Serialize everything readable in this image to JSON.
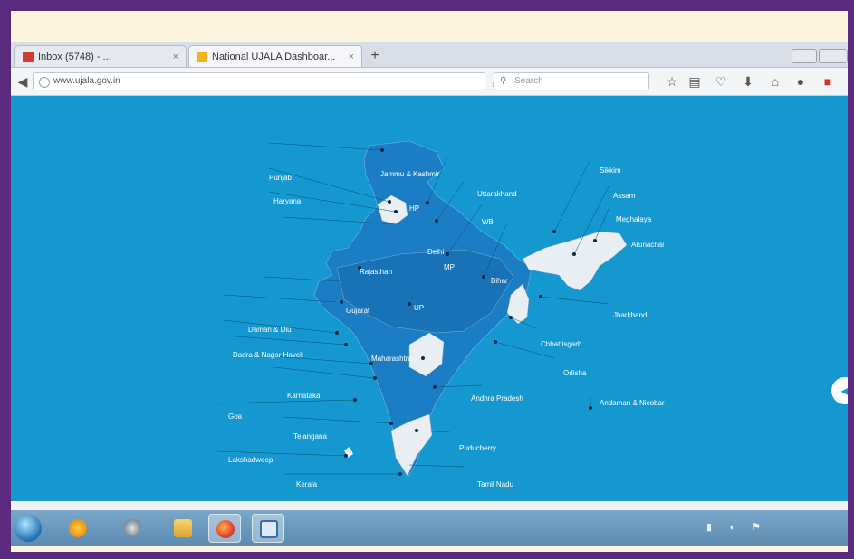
{
  "browser": {
    "tabs": [
      {
        "label": "Inbox (5748) - ...",
        "active": false,
        "icon": "gmail-icon"
      },
      {
        "label": "National UJALA Dashboar...",
        "active": true,
        "icon": "ujala-icon"
      }
    ],
    "tab_close_glyph": "×",
    "new_tab_glyph": "+",
    "url": "www.ujala.gov.in",
    "search_placeholder": "Search",
    "toolbar_icons": [
      "star-icon",
      "reading-list-icon",
      "pocket-icon",
      "download-icon",
      "home-icon",
      "chat-icon",
      "addon-icon"
    ]
  },
  "map": {
    "background": "#1598cf",
    "region_color": "#1b7ec4",
    "highlight_color": "#e8eef2",
    "state_labels": {
      "jk": "Jammu & Kashmir",
      "punjab": "Punjab",
      "haryana": "Haryana",
      "hp": "HP",
      "delhi": "Delhi",
      "uttarakhand": "Uttarakhand",
      "rajasthan": "Rajasthan",
      "up": "UP",
      "bihar": "Bihar",
      "gujarat": "Gujarat",
      "mp": "MP",
      "daman_diu": "Daman & Diu",
      "dnh": "Dadra & Nagar Haveli",
      "maharashtra": "Maharashtra",
      "goa": "Goa",
      "karnataka": "Karnataka",
      "telangana": "Telangana",
      "ap": "Andhra Pradesh",
      "kerala": "Kerala",
      "tamil_nadu": "Tamil Nadu",
      "puducherry": "Puducherry",
      "lakshadweep": "Lakshadweep",
      "chhattisgarh": "Chhattisgarh",
      "odisha": "Odisha",
      "jharkhand": "Jharkhand",
      "sikkim": "Sikkim",
      "assam": "Assam",
      "meghalaya": "Meghalaya",
      "arunachal": "Arunachal",
      "andaman": "Andaman & Nicobar",
      "wb": "WB"
    }
  },
  "taskbar": {
    "apps": [
      "windows-start-icon",
      "media-player-icon",
      "generic-app-icon",
      "file-explorer-icon",
      "firefox-icon",
      "app-window-icon"
    ],
    "tray": [
      "speaker-icon",
      "network-icon",
      "flag-icon"
    ]
  }
}
